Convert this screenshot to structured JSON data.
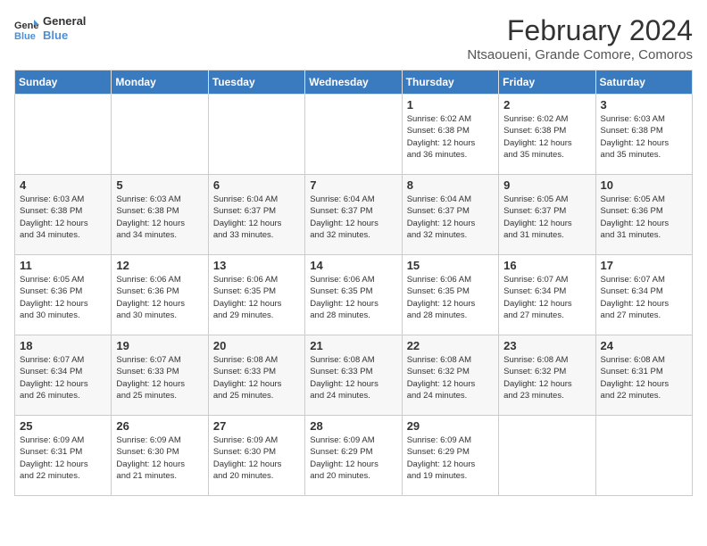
{
  "header": {
    "logo_line1": "General",
    "logo_line2": "Blue",
    "month_title": "February 2024",
    "subtitle": "Ntsaoueni, Grande Comore, Comoros"
  },
  "days_of_week": [
    "Sunday",
    "Monday",
    "Tuesday",
    "Wednesday",
    "Thursday",
    "Friday",
    "Saturday"
  ],
  "weeks": [
    [
      {
        "day": "",
        "info": ""
      },
      {
        "day": "",
        "info": ""
      },
      {
        "day": "",
        "info": ""
      },
      {
        "day": "",
        "info": ""
      },
      {
        "day": "1",
        "info": "Sunrise: 6:02 AM\nSunset: 6:38 PM\nDaylight: 12 hours\nand 36 minutes."
      },
      {
        "day": "2",
        "info": "Sunrise: 6:02 AM\nSunset: 6:38 PM\nDaylight: 12 hours\nand 35 minutes."
      },
      {
        "day": "3",
        "info": "Sunrise: 6:03 AM\nSunset: 6:38 PM\nDaylight: 12 hours\nand 35 minutes."
      }
    ],
    [
      {
        "day": "4",
        "info": "Sunrise: 6:03 AM\nSunset: 6:38 PM\nDaylight: 12 hours\nand 34 minutes."
      },
      {
        "day": "5",
        "info": "Sunrise: 6:03 AM\nSunset: 6:38 PM\nDaylight: 12 hours\nand 34 minutes."
      },
      {
        "day": "6",
        "info": "Sunrise: 6:04 AM\nSunset: 6:37 PM\nDaylight: 12 hours\nand 33 minutes."
      },
      {
        "day": "7",
        "info": "Sunrise: 6:04 AM\nSunset: 6:37 PM\nDaylight: 12 hours\nand 32 minutes."
      },
      {
        "day": "8",
        "info": "Sunrise: 6:04 AM\nSunset: 6:37 PM\nDaylight: 12 hours\nand 32 minutes."
      },
      {
        "day": "9",
        "info": "Sunrise: 6:05 AM\nSunset: 6:37 PM\nDaylight: 12 hours\nand 31 minutes."
      },
      {
        "day": "10",
        "info": "Sunrise: 6:05 AM\nSunset: 6:36 PM\nDaylight: 12 hours\nand 31 minutes."
      }
    ],
    [
      {
        "day": "11",
        "info": "Sunrise: 6:05 AM\nSunset: 6:36 PM\nDaylight: 12 hours\nand 30 minutes."
      },
      {
        "day": "12",
        "info": "Sunrise: 6:06 AM\nSunset: 6:36 PM\nDaylight: 12 hours\nand 30 minutes."
      },
      {
        "day": "13",
        "info": "Sunrise: 6:06 AM\nSunset: 6:35 PM\nDaylight: 12 hours\nand 29 minutes."
      },
      {
        "day": "14",
        "info": "Sunrise: 6:06 AM\nSunset: 6:35 PM\nDaylight: 12 hours\nand 28 minutes."
      },
      {
        "day": "15",
        "info": "Sunrise: 6:06 AM\nSunset: 6:35 PM\nDaylight: 12 hours\nand 28 minutes."
      },
      {
        "day": "16",
        "info": "Sunrise: 6:07 AM\nSunset: 6:34 PM\nDaylight: 12 hours\nand 27 minutes."
      },
      {
        "day": "17",
        "info": "Sunrise: 6:07 AM\nSunset: 6:34 PM\nDaylight: 12 hours\nand 27 minutes."
      }
    ],
    [
      {
        "day": "18",
        "info": "Sunrise: 6:07 AM\nSunset: 6:34 PM\nDaylight: 12 hours\nand 26 minutes."
      },
      {
        "day": "19",
        "info": "Sunrise: 6:07 AM\nSunset: 6:33 PM\nDaylight: 12 hours\nand 25 minutes."
      },
      {
        "day": "20",
        "info": "Sunrise: 6:08 AM\nSunset: 6:33 PM\nDaylight: 12 hours\nand 25 minutes."
      },
      {
        "day": "21",
        "info": "Sunrise: 6:08 AM\nSunset: 6:33 PM\nDaylight: 12 hours\nand 24 minutes."
      },
      {
        "day": "22",
        "info": "Sunrise: 6:08 AM\nSunset: 6:32 PM\nDaylight: 12 hours\nand 24 minutes."
      },
      {
        "day": "23",
        "info": "Sunrise: 6:08 AM\nSunset: 6:32 PM\nDaylight: 12 hours\nand 23 minutes."
      },
      {
        "day": "24",
        "info": "Sunrise: 6:08 AM\nSunset: 6:31 PM\nDaylight: 12 hours\nand 22 minutes."
      }
    ],
    [
      {
        "day": "25",
        "info": "Sunrise: 6:09 AM\nSunset: 6:31 PM\nDaylight: 12 hours\nand 22 minutes."
      },
      {
        "day": "26",
        "info": "Sunrise: 6:09 AM\nSunset: 6:30 PM\nDaylight: 12 hours\nand 21 minutes."
      },
      {
        "day": "27",
        "info": "Sunrise: 6:09 AM\nSunset: 6:30 PM\nDaylight: 12 hours\nand 20 minutes."
      },
      {
        "day": "28",
        "info": "Sunrise: 6:09 AM\nSunset: 6:29 PM\nDaylight: 12 hours\nand 20 minutes."
      },
      {
        "day": "29",
        "info": "Sunrise: 6:09 AM\nSunset: 6:29 PM\nDaylight: 12 hours\nand 19 minutes."
      },
      {
        "day": "",
        "info": ""
      },
      {
        "day": "",
        "info": ""
      }
    ]
  ]
}
